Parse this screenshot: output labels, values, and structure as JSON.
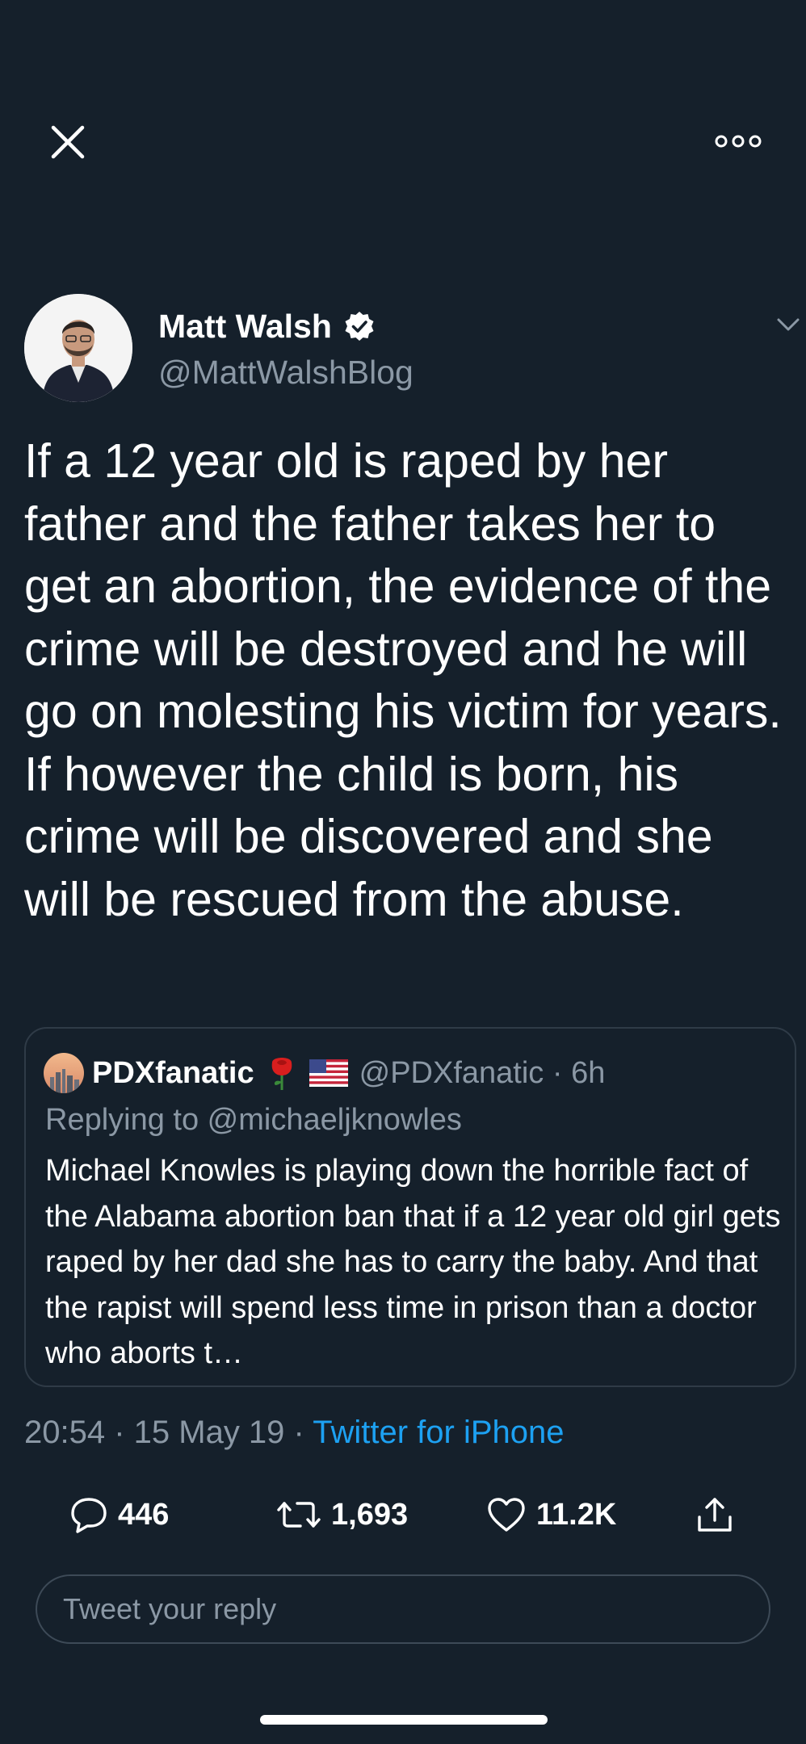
{
  "topbar": {
    "close_icon": "close-icon",
    "more_icon": "more-options-icon"
  },
  "author": {
    "name": "Matt Walsh",
    "verified": true,
    "handle": "@MattWalshBlog"
  },
  "tweet": {
    "text": "If a 12 year old is raped by her father and the father takes her to get an abortion, the evidence of the crime will be destroyed and he will go on molesting his victim for years. If however the child is born, his crime will be discovered and she will be rescued from the abuse."
  },
  "quote": {
    "name": "PDXfanatic",
    "emoji": [
      "rose",
      "us-flag"
    ],
    "handle_time": "@PDXfanatic · 6h",
    "replying_prefix": "Replying to ",
    "replying_to": "@michaeljknowles",
    "text": "Michael Knowles is playing down the horrible fact of the Alabama abortion ban that if a 12 year old girl gets raped by her dad she has to carry the baby. And that the rapist will spend less time in prison than a doctor who aborts t…"
  },
  "meta": {
    "datetime": "20:54 · 15 May 19 · ",
    "source": "Twitter for iPhone"
  },
  "actions": {
    "replies": "446",
    "retweets": "1,693",
    "likes": "11.2K"
  },
  "reply_box": {
    "placeholder": "Tweet your reply"
  },
  "colors": {
    "background": "#15202b",
    "secondary_text": "#8b98a5",
    "link": "#1da1f2",
    "border": "#2f3b47"
  }
}
